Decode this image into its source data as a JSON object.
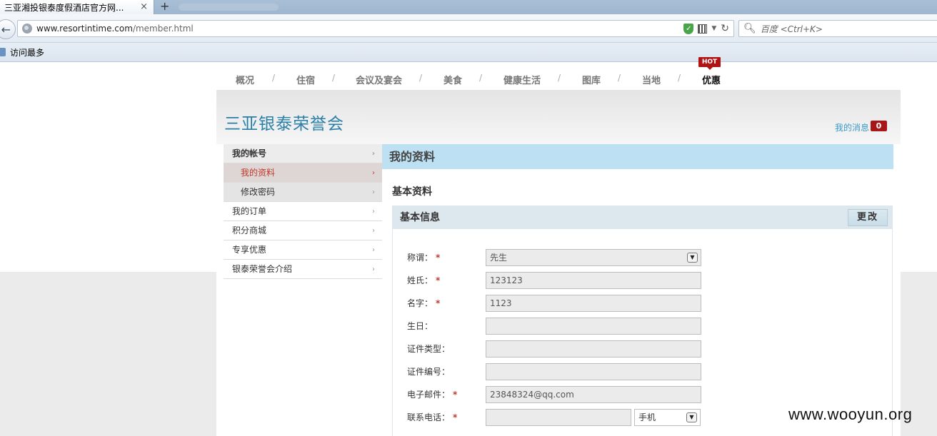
{
  "browser": {
    "tab_title": "三亚湘投银泰度假酒店官方网...",
    "tab_close": "×",
    "new_tab": "+",
    "url_host": "www.resortintime.com",
    "url_path": "/member.html",
    "search_placeholder": "百度 <Ctrl+K>",
    "bookmark": "访问最多"
  },
  "topnav": {
    "items": [
      {
        "label": "概况"
      },
      {
        "label": "住宿"
      },
      {
        "label": "会议及宴会"
      },
      {
        "label": "美食"
      },
      {
        "label": "健康生活"
      },
      {
        "label": "图库"
      },
      {
        "label": "当地"
      },
      {
        "label": "优惠"
      }
    ],
    "separator": "/",
    "hot_badge": "HOT"
  },
  "header": {
    "brand": "三亚银泰荣誉会",
    "messages_label": "我的消息",
    "messages_count": "0"
  },
  "sidebar": {
    "arrow": "›",
    "items": [
      {
        "label": "我的帐号"
      },
      {
        "label": "我的资料"
      },
      {
        "label": "修改密码"
      },
      {
        "label": "我的订单"
      },
      {
        "label": "积分商城"
      },
      {
        "label": "专享优惠"
      },
      {
        "label": "银泰荣誉会介绍"
      }
    ]
  },
  "content": {
    "title": "我的资料",
    "section_title": "基本资料",
    "box_title": "基本信息",
    "edit_label": "更改",
    "required_mark": "*",
    "fields": {
      "salutation": {
        "label": "称谓：",
        "value": "先生"
      },
      "surname": {
        "label": "姓氏：",
        "value": "123123"
      },
      "given_name": {
        "label": "名字：",
        "value": "1123"
      },
      "birthday": {
        "label": "生日：",
        "value": ""
      },
      "id_type": {
        "label": "证件类型：",
        "value": ""
      },
      "id_number": {
        "label": "证件编号：",
        "value": ""
      },
      "email": {
        "label": "电子邮件：",
        "value": "23848324@qq.com"
      },
      "phone": {
        "label": "联系电话：",
        "value": "",
        "type": "手机"
      }
    }
  },
  "watermark": "www.wooyun.org"
}
